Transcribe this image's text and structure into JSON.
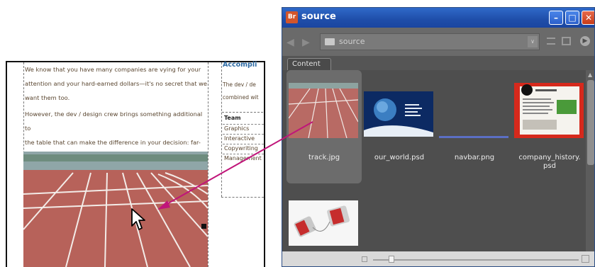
{
  "document": {
    "paragraph1": "We know that you have many companies are vying for your\nattention and your hard-earned dollars—it's no secret that we\nwant them too.",
    "paragraph2": "However, the dev / design crew brings something additional to\nthe table that can make the difference in your decision: far-\nreaching experience.",
    "sidebar_heading": "Accompli",
    "sidebar_text_1": "The dev / de",
    "sidebar_text_2": "combined wit",
    "team_title": "Team",
    "team_items": [
      "Graphics",
      "Interactive",
      "Copywriting",
      "Management"
    ]
  },
  "bridge": {
    "window_title": "source",
    "app_icon": "Br",
    "path": "source",
    "tab": "Content",
    "items": [
      {
        "label": "track.jpg",
        "selected": true
      },
      {
        "label": "our_world.psd",
        "selected": false
      },
      {
        "label": "navbar.png",
        "selected": false
      },
      {
        "label": "company_history.\npsd",
        "selected": false
      },
      {
        "label": "",
        "selected": false
      }
    ],
    "icons": {
      "back": "back-arrow-icon",
      "forward": "forward-arrow-icon",
      "folder": "folder-icon",
      "minimize": "minimize-icon",
      "maximize": "maximize-icon",
      "close": "close-icon"
    }
  },
  "colors": {
    "title_bar": "#1f4ea9",
    "panel_bg": "#4e4e4e",
    "drag_arrow": "#c0157a",
    "heading_blue": "#2d6aa3",
    "track_red": "#b7625a"
  }
}
